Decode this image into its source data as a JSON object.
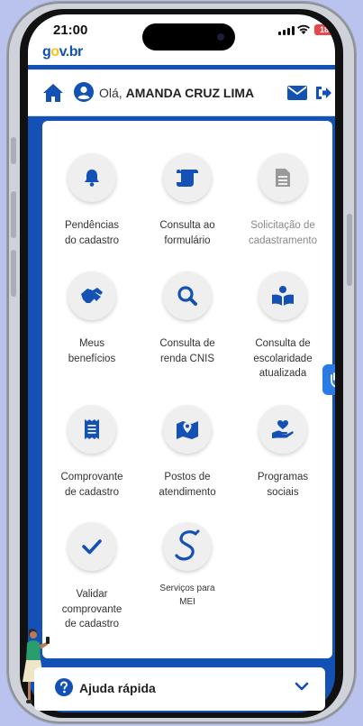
{
  "status_bar": {
    "time": "21:00",
    "battery": "18"
  },
  "logo": {
    "g": "g",
    "o": "o",
    "v": "v",
    "dot": ".",
    "br": "br"
  },
  "header": {
    "greeting_prefix": "Olá, ",
    "user_name": "AMANDA CRUZ LIMA"
  },
  "menu": [
    {
      "label_1": "Pendências",
      "label_2": "do cadastro",
      "icon": "bell-icon"
    },
    {
      "label_1": "Consulta ao",
      "label_2": "formulário",
      "icon": "scroll-icon"
    },
    {
      "label_1": "Solicitação de",
      "label_2": "cadastramento",
      "icon": "document-icon",
      "disabled": true
    },
    {
      "label_1": "Meus",
      "label_2": "benefícios",
      "icon": "handshake-icon"
    },
    {
      "label_1": "Consulta de",
      "label_2": "renda CNIS",
      "icon": "magnifier-icon"
    },
    {
      "label_1": "Consulta de",
      "label_2": "escolaridade",
      "label_3": "atualizada",
      "icon": "book-reader-icon"
    },
    {
      "label_1": "Comprovante",
      "label_2": "de cadastro",
      "icon": "receipt-icon"
    },
    {
      "label_1": "Postos de",
      "label_2": "atendimento",
      "icon": "map-icon"
    },
    {
      "label_1": "Programas",
      "label_2": "sociais",
      "icon": "hand-heart-icon"
    },
    {
      "label_1": "Validar",
      "label_2": "comprovante",
      "label_3": "de cadastro",
      "icon": "check-icon"
    },
    {
      "label_1": "Serviços para",
      "label_2": "MEI",
      "icon": "mei-s-icon"
    }
  ],
  "help": {
    "label": "Ajuda rápida"
  },
  "colors": {
    "primary": "#1351b4",
    "disabled_icon": "#9a9a9a",
    "accessibility_badge": "#2c7be5"
  }
}
